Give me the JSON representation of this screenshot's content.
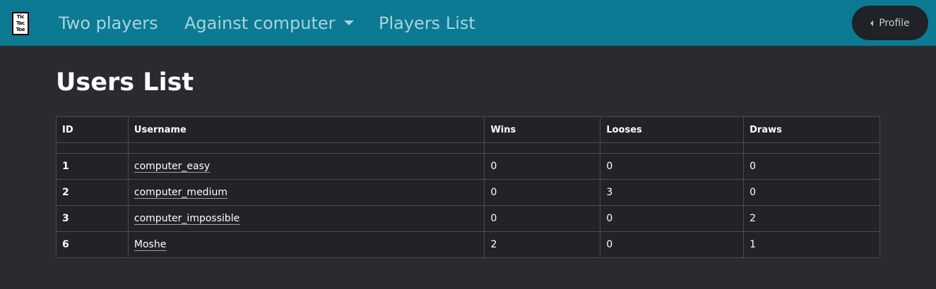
{
  "navbar": {
    "logo_lines": [
      "Tic",
      "Tac",
      "Toe"
    ],
    "links": {
      "two_players": "Two players",
      "against_computer": "Against computer",
      "players_list": "Players List"
    },
    "profile_label": "Profile"
  },
  "page": {
    "title": "Users List"
  },
  "table": {
    "headers": {
      "id": "ID",
      "username": "Username",
      "wins": "Wins",
      "looses": "Looses",
      "draws": "Draws"
    },
    "rows": [
      {
        "id": "1",
        "username": "computer_easy",
        "wins": "0",
        "looses": "0",
        "draws": "0"
      },
      {
        "id": "2",
        "username": "computer_medium",
        "wins": "0",
        "looses": "3",
        "draws": "0"
      },
      {
        "id": "3",
        "username": "computer_impossible",
        "wins": "0",
        "looses": "0",
        "draws": "2"
      },
      {
        "id": "6",
        "username": "Moshe",
        "wins": "2",
        "looses": "0",
        "draws": "1"
      }
    ]
  },
  "colors": {
    "navbar_bg": "#0b7a92",
    "page_bg": "#292b30",
    "table_bg": "#212327",
    "nav_link": "#a9d3de",
    "profile_bg": "#1f2226"
  },
  "icons": {
    "dropdown": "caret-down-icon",
    "profile": "caret-left-icon"
  }
}
